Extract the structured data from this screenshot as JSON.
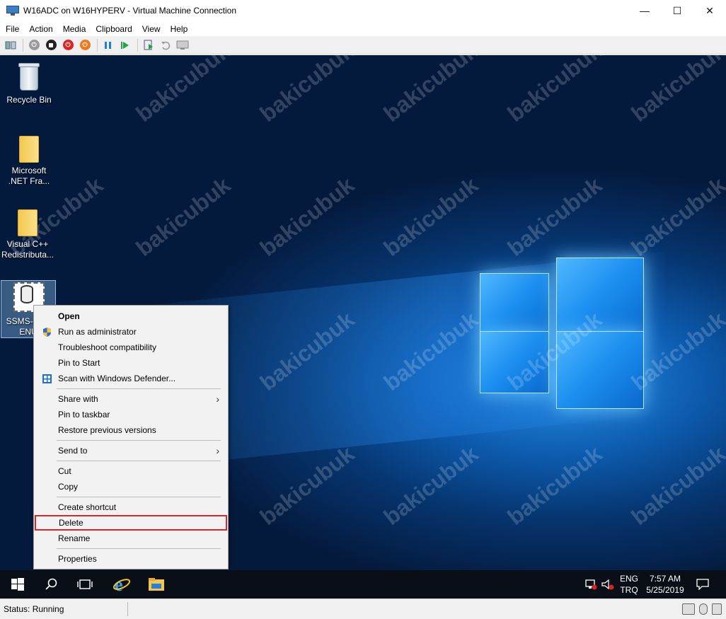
{
  "window": {
    "title": "W16ADC on W16HYPERV - Virtual Machine Connection",
    "minimize": "—",
    "maximize": "☐",
    "close": "✕"
  },
  "menu": [
    "File",
    "Action",
    "Media",
    "Clipboard",
    "View",
    "Help"
  ],
  "toolbar": {
    "icons": [
      "ctrl-alt-del-icon",
      "start-icon",
      "turn-off-icon",
      "shutdown-icon",
      "save-icon",
      "pause-icon",
      "resume-icon",
      "checkpoint-icon",
      "revert-icon",
      "enhanced-session-icon"
    ]
  },
  "desktop": {
    "icons": [
      {
        "label": "Recycle Bin"
      },
      {
        "label": "Microsoft .NET Fra..."
      },
      {
        "label": "Visual C++ Redistributa..."
      },
      {
        "label": "SSMS-Se... ENU"
      }
    ]
  },
  "context_menu": {
    "items": [
      {
        "label": "Open"
      },
      {
        "label": "Run as administrator"
      },
      {
        "label": "Troubleshoot compatibility"
      },
      {
        "label": "Pin to Start"
      },
      {
        "label": "Scan with Windows Defender..."
      },
      {
        "label": "Share with"
      },
      {
        "label": "Pin to taskbar"
      },
      {
        "label": "Restore previous versions"
      },
      {
        "label": "Send to"
      },
      {
        "label": "Cut"
      },
      {
        "label": "Copy"
      },
      {
        "label": "Create shortcut"
      },
      {
        "label": "Delete"
      },
      {
        "label": "Rename"
      },
      {
        "label": "Properties"
      }
    ],
    "highlighted": "Delete",
    "highlight_color": "#d62a2a"
  },
  "taskbar": {
    "lang_top": "ENG",
    "lang_bottom": "TRQ",
    "time": "7:57 AM",
    "date": "5/25/2019"
  },
  "status": {
    "text": "Status: Running"
  },
  "watermark": "bakicubuk"
}
